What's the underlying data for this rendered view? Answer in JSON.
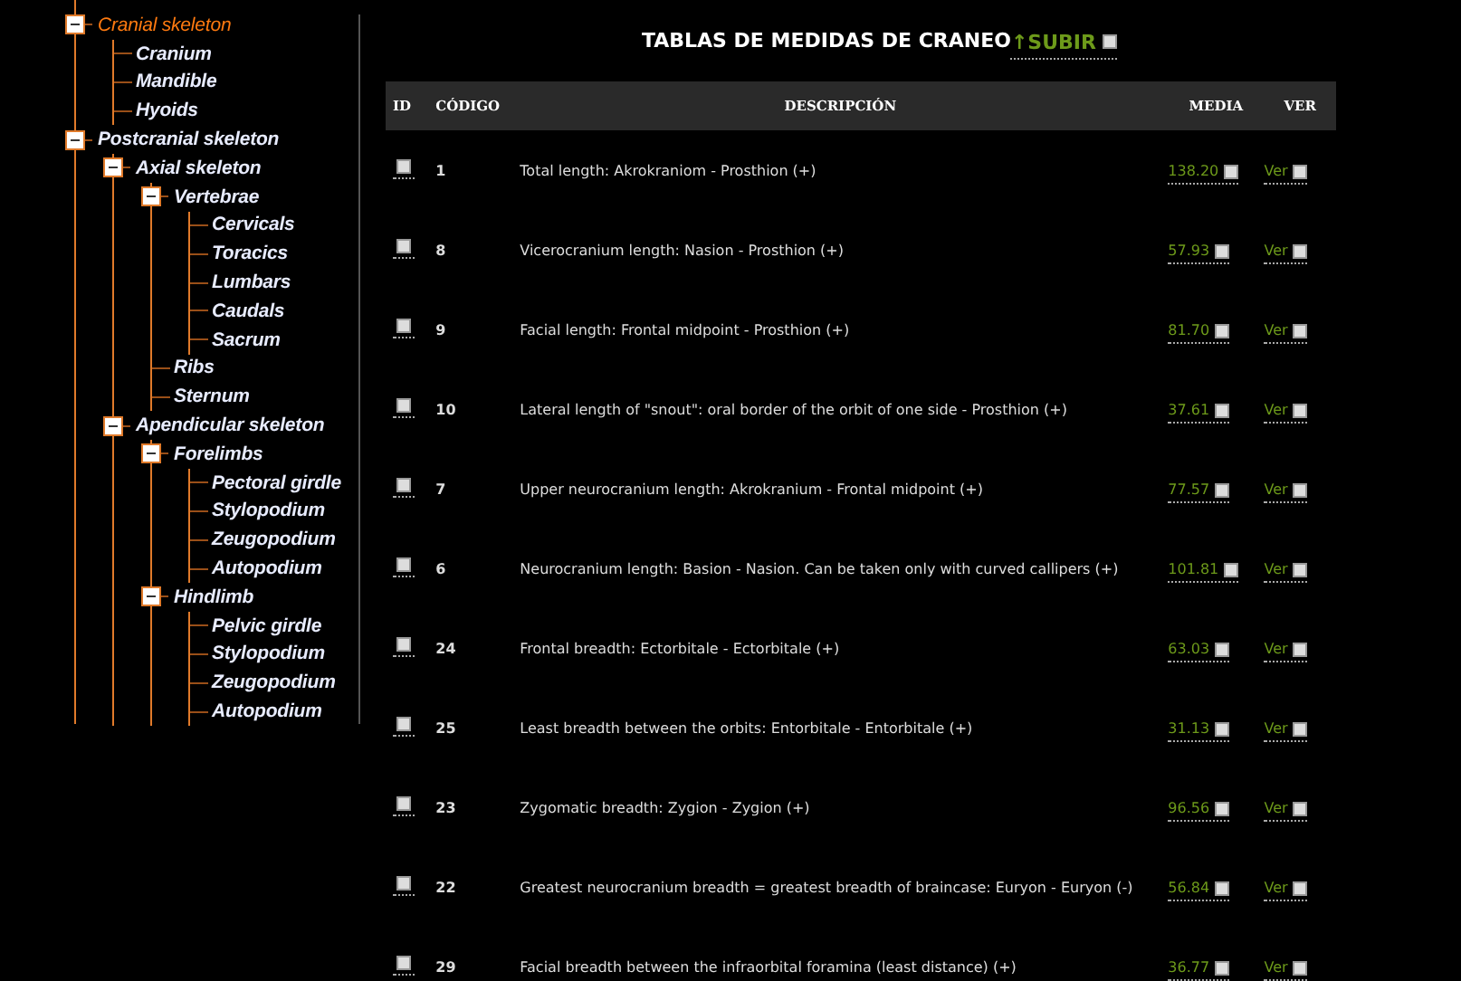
{
  "tree": [
    {
      "label": "Cranial skeleton",
      "selected": true,
      "expanded": true,
      "children": [
        {
          "label": "Cranium",
          "selected": false
        },
        {
          "label": "Mandible",
          "selected": false
        },
        {
          "label": "Hyoids",
          "selected": false
        }
      ]
    },
    {
      "label": "Postcranial skeleton",
      "selected": false,
      "expanded": true,
      "children": [
        {
          "label": "Axial skeleton",
          "selected": false,
          "expanded": true,
          "children": [
            {
              "label": "Vertebrae",
              "selected": false,
              "expanded": true,
              "children": [
                {
                  "label": "Cervicals",
                  "selected": false
                },
                {
                  "label": "Toracics",
                  "selected": false
                },
                {
                  "label": "Lumbars",
                  "selected": false
                },
                {
                  "label": "Caudals",
                  "selected": false
                },
                {
                  "label": "Sacrum",
                  "selected": false
                }
              ]
            },
            {
              "label": "Ribs",
              "selected": false
            },
            {
              "label": "Sternum",
              "selected": false
            }
          ]
        },
        {
          "label": "Apendicular skeleton",
          "selected": false,
          "expanded": true,
          "children": [
            {
              "label": "Forelimbs",
              "selected": false,
              "expanded": true,
              "children": [
                {
                  "label": "Pectoral girdle",
                  "selected": false
                },
                {
                  "label": "Stylopodium",
                  "selected": false
                },
                {
                  "label": "Zeugopodium",
                  "selected": false
                },
                {
                  "label": "Autopodium",
                  "selected": false
                }
              ]
            },
            {
              "label": "Hindlimb",
              "selected": false,
              "expanded": true,
              "children": [
                {
                  "label": "Pelvic girdle",
                  "selected": false
                },
                {
                  "label": "Stylopodium",
                  "selected": false
                },
                {
                  "label": "Zeugopodium",
                  "selected": false
                },
                {
                  "label": "Autopodium",
                  "selected": false
                }
              ]
            }
          ]
        }
      ]
    }
  ],
  "heading": {
    "title": "TABLAS DE MEDIDAS DE CRANEO",
    "link": "↑SUBIR"
  },
  "table": {
    "columns": [
      "ID",
      "CÓDIGO",
      "DESCRIPCIÓN",
      "MEDIA",
      "VER"
    ],
    "rows": [
      {
        "code": "1",
        "description": "Total length: Akrokraniom - Prosthion (+)",
        "media": "138.20",
        "ver": "Ver"
      },
      {
        "code": "8",
        "description": "Vicerocranium length: Nasion - Prosthion (+)",
        "media": "57.93",
        "ver": "Ver"
      },
      {
        "code": "9",
        "description": "Facial length: Frontal midpoint - Prosthion (+)",
        "media": "81.70",
        "ver": "Ver"
      },
      {
        "code": "10",
        "description": "Lateral length of \"snout\": oral border of the orbit of one side - Prosthion (+)",
        "media": "37.61",
        "ver": "Ver"
      },
      {
        "code": "7",
        "description": "Upper neurocranium length: Akrokranium - Frontal midpoint (+)",
        "media": "77.57",
        "ver": "Ver"
      },
      {
        "code": "6",
        "description": "Neurocranium length: Basion - Nasion. Can be taken only with curved callipers (+)",
        "media": "101.81",
        "ver": "Ver"
      },
      {
        "code": "24",
        "description": "Frontal breadth: Ectorbitale - Ectorbitale (+)",
        "media": "63.03",
        "ver": "Ver"
      },
      {
        "code": "25",
        "description": "Least breadth between the orbits: Entorbitale - Entorbitale (+)",
        "media": "31.13",
        "ver": "Ver"
      },
      {
        "code": "23",
        "description": "Zygomatic breadth: Zygion - Zygion (+)",
        "media": "96.56",
        "ver": "Ver"
      },
      {
        "code": "22",
        "description": "Greatest neurocranium breadth = greatest breadth of braincase: Euryon - Euryon (-)",
        "media": "56.84",
        "ver": "Ver"
      },
      {
        "code": "29",
        "description": "Facial breadth between the infraorbital foramina (least distance) (+)",
        "media": "36.77",
        "ver": "Ver"
      }
    ]
  }
}
